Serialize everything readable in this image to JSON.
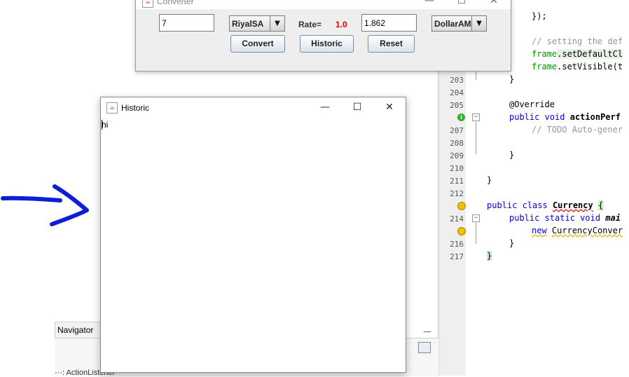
{
  "converter": {
    "title": "Converter",
    "amount_value": "7",
    "from_currency": "RiyalSA",
    "rate_label": "Rate=",
    "rate_value": "1.0",
    "result_value": "1.862",
    "to_currency": "DollarAM",
    "buttons": {
      "convert": "Convert",
      "historic": "Historic",
      "reset": "Reset"
    }
  },
  "historic": {
    "title": "Historic",
    "content": "hi"
  },
  "window_controls": {
    "minimize": "—",
    "maximize": "☐",
    "close": "✕"
  },
  "navigator": {
    "tab_label": "Navigator",
    "tab_close": "×",
    "minimize": "—",
    "cut_text": "···: ActionListener"
  },
  "editor": {
    "line_numbers": [
      "203",
      "204",
      "205",
      "",
      "207",
      "208",
      "209",
      "210",
      "211",
      "212",
      "",
      "214",
      "",
      "216",
      "217"
    ],
    "lines": {
      "l_close_paren": "});",
      "l_comment1": "// setting the def",
      "l_frame1_obj": "frame",
      "l_frame1_call": ".setDefaultCl",
      "l_frame2_obj": "frame",
      "l_frame2_call": ".setVisible(t",
      "l_brace203": "}",
      "l_override": "@Override",
      "l_public_void_kw": "public void",
      "l_action": "actionPerf",
      "l_todo": "// TODO Auto-gener",
      "l_brace209": "}",
      "l_brace211": "}",
      "l_public_class_kw": "public class",
      "l_currency": "Currency",
      "l_open_brace": "{",
      "l_public_static_kw": "public static void",
      "l_main": "mai",
      "l_new_kw": "new",
      "l_new_target": "CurrencyConver",
      "l_brace216": "}",
      "l_brace217": "}"
    }
  },
  "colors": {
    "rate_value": "#e00000",
    "keyword": "#0000e6",
    "comment": "#969696",
    "field": "#009900",
    "annotation_arrow": "#0a1fd6"
  }
}
